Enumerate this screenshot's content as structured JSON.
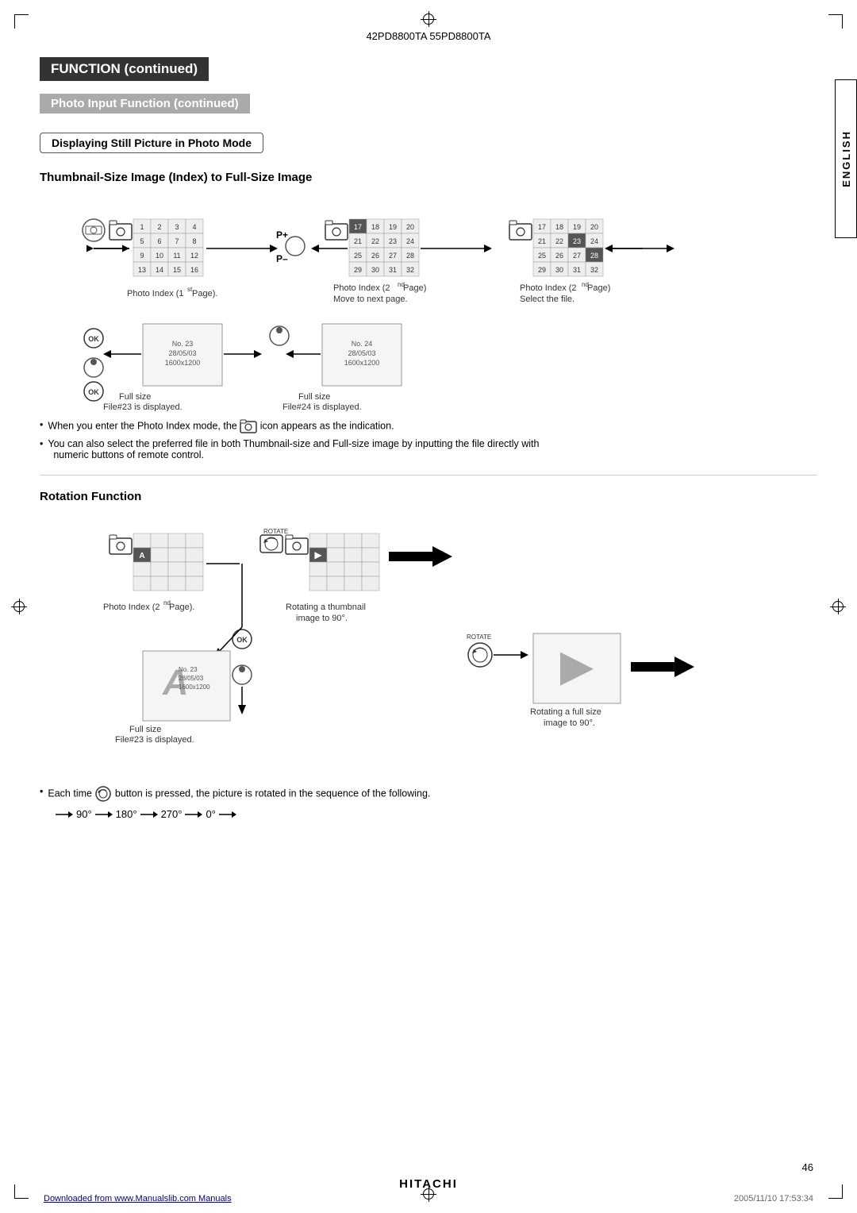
{
  "header": {
    "model_numbers": "42PD8800TA  55PD8800TA"
  },
  "section1": {
    "function_label": "FUNCTION (continued)",
    "photo_input_label": "Photo Input Function (continued)",
    "displaying_label": "Displaying Still Picture in Photo Mode",
    "thumbnail_title": "Thumbnail-Size Image (Index) to Full-Size Image"
  },
  "photo_index_1": {
    "label": "Photo Index (1st Page).",
    "cells": [
      "1",
      "2",
      "3",
      "4",
      "5",
      "6",
      "7",
      "8",
      "9",
      "10",
      "11",
      "12",
      "13",
      "14",
      "15",
      "16"
    ]
  },
  "photo_index_2": {
    "label": "Photo Index (2nd Page)\nMove to next page.",
    "cells": [
      "17",
      "18",
      "19",
      "20",
      "21",
      "22",
      "23",
      "24",
      "25",
      "26",
      "27",
      "28",
      "29",
      "30",
      "31",
      "32"
    ],
    "highlighted": [
      "17"
    ]
  },
  "photo_index_3": {
    "label": "Photo Index (2nd Page)\nSelect the file.",
    "cells": [
      "17",
      "18",
      "19",
      "20",
      "21",
      "22",
      "23",
      "24",
      "25",
      "26",
      "27",
      "28",
      "29",
      "30",
      "31",
      "32"
    ],
    "highlighted": [
      "23"
    ]
  },
  "fullsize_1": {
    "info": "No. 23\n28/05/03\n1600x1200",
    "label": "Full size\nFile#23 is displayed."
  },
  "fullsize_2": {
    "info": "No. 24\n28/05/03\n1600x1200",
    "label": "Full size\nFile#24 is displayed."
  },
  "bullets": {
    "bullet1": "When you enter the Photo Index mode, the      icon appears as the indication.",
    "bullet2": "You can also select the preferred file in both Thumbnail-size and Full-size image by inputting the file directly with numeric buttons of remote control."
  },
  "section2": {
    "rotation_title": "Rotation Function"
  },
  "rotation_index": {
    "label": "Photo Index (2nd Page).",
    "has_highlighted": true
  },
  "rotation_thumb": {
    "label": "Rotating a thumbnail\nimage to 90°."
  },
  "rotation_full_label": "Full size\nFile#23 is displayed.",
  "rotation_full_info": "No. 23\n28/05/03\n1600x1200",
  "rotating_full_label": "Rotating a full size\nimage to 90°.",
  "rotate_button_label": "ROTATE",
  "each_time_text": "Each time      button is pressed, the picture is rotated in the sequence of the following.",
  "rotation_sequence": "→ 90° → 180° → 270° → 0° →",
  "footer": {
    "brand": "HITACHI",
    "page_number": "46",
    "link": "Downloaded from www.Manualslib.com Manuals",
    "date": "2005/11/10  17:53:34"
  },
  "english_sidebar": "ENGLISH",
  "p_plus_label": "P+",
  "p_minus_label": "P–"
}
